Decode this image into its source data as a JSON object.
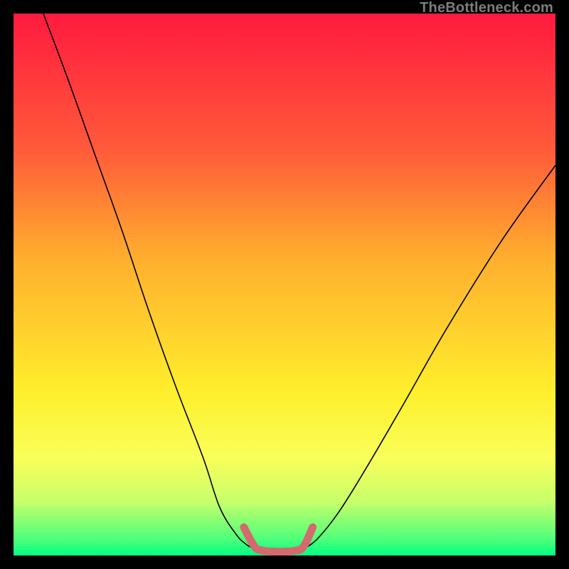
{
  "watermark": "TheBottleneck.com",
  "chart_data": {
    "type": "line",
    "title": "",
    "xlabel": "",
    "ylabel": "",
    "xlim": [
      0,
      100
    ],
    "ylim": [
      0,
      100
    ],
    "grid": false,
    "legend": false,
    "background": "rainbow-vertical-gradient",
    "gradient_stops": [
      {
        "pos": 0.0,
        "color": "#ff1a3f"
      },
      {
        "pos": 0.25,
        "color": "#ff5a3a"
      },
      {
        "pos": 0.45,
        "color": "#ffae2e"
      },
      {
        "pos": 0.7,
        "color": "#ffef2c"
      },
      {
        "pos": 0.82,
        "color": "#f9ff5a"
      },
      {
        "pos": 0.9,
        "color": "#c8ff6a"
      },
      {
        "pos": 0.97,
        "color": "#4eff7a"
      },
      {
        "pos": 1.0,
        "color": "#00ff84"
      }
    ],
    "series": [
      {
        "name": "left-branch",
        "type": "line",
        "color": "#000000",
        "width": 1.6,
        "x": [
          5.5,
          10,
          15,
          20,
          25,
          30,
          35,
          38,
          41,
          43,
          44.5
        ],
        "y": [
          100,
          88,
          74,
          60,
          45,
          31,
          18,
          9,
          4,
          2,
          1.2
        ]
      },
      {
        "name": "right-branch",
        "type": "line",
        "color": "#000000",
        "width": 1.6,
        "x": [
          53.5,
          56,
          60,
          65,
          72,
          80,
          90,
          100
        ],
        "y": [
          1.2,
          3,
          8,
          16,
          28,
          42,
          58,
          72
        ]
      },
      {
        "name": "valley-highlight",
        "type": "line",
        "color": "#d36a6d",
        "width": 11,
        "linecap": "round",
        "x": [
          42.5,
          44.5,
          46,
          48,
          50,
          52,
          53.5,
          55.2
        ],
        "y": [
          5.2,
          1.6,
          0.9,
          0.7,
          0.7,
          0.9,
          1.6,
          5.2
        ]
      }
    ]
  }
}
